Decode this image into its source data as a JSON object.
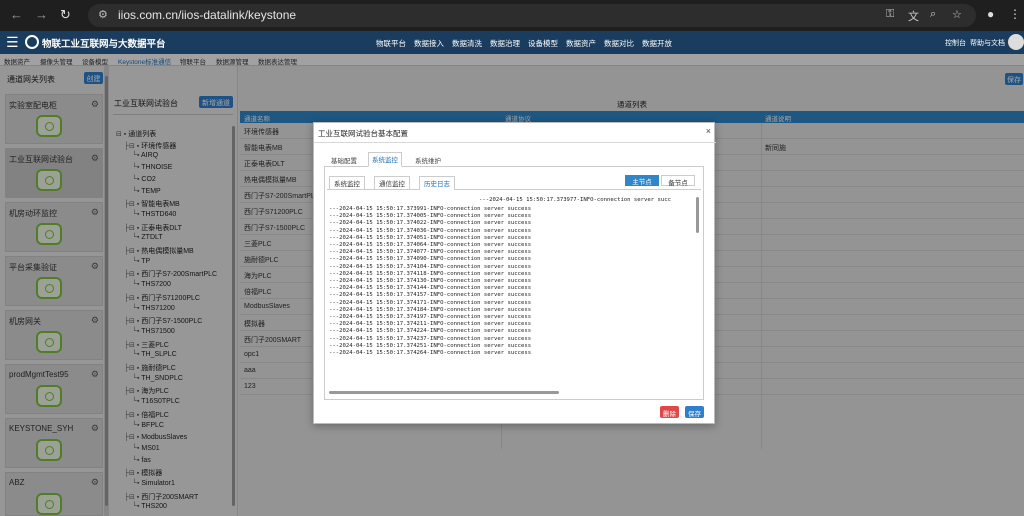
{
  "browser": {
    "url": "iios.com.cn/iios-datalink/keystone"
  },
  "header": {
    "brand": "物联工业互联网与大数据平台",
    "nav": [
      "物联平台",
      "数据接入",
      "数据清洗",
      "数据治理",
      "设备模型",
      "数据资产",
      "数据对比",
      "数据开放"
    ],
    "right": [
      "控制台",
      "帮助与文档"
    ]
  },
  "subnav": [
    "数据资产",
    "摄像头管理",
    "设备模型",
    "Keystone标准通信",
    "物联平台",
    "数据源管理",
    "数据表达管理"
  ],
  "left": {
    "title": "通道网关列表",
    "create": "创建",
    "gateways": [
      "实验室配电柜",
      "工业互联网试验台",
      "机房动环监控",
      "平台采集验证",
      "机房网关",
      "prodMgmtTest95",
      "KEYSTONE_SYH",
      "ABZ"
    ]
  },
  "tree": {
    "title": "工业互联网试验台",
    "new_channel": "新增通道",
    "nodes": [
      {
        "t": "通道列表",
        "d": 0
      },
      {
        "t": "环境传感器",
        "d": 1
      },
      {
        "t": "AIRQ",
        "d": 2
      },
      {
        "t": "THNOISE",
        "d": 2
      },
      {
        "t": "CO2",
        "d": 2
      },
      {
        "t": "TEMP",
        "d": 2
      },
      {
        "t": "智能电表MB",
        "d": 1
      },
      {
        "t": "THSTD640",
        "d": 2
      },
      {
        "t": "正泰电表DLT",
        "d": 1
      },
      {
        "t": "ZTDLT",
        "d": 2
      },
      {
        "t": "热电偶模拟量MB",
        "d": 1
      },
      {
        "t": "TP",
        "d": 2
      },
      {
        "t": "西门子S7-200SmartPLC",
        "d": 1
      },
      {
        "t": "THS7200",
        "d": 2
      },
      {
        "t": "西门子S71200PLC",
        "d": 1
      },
      {
        "t": "THS71200",
        "d": 2
      },
      {
        "t": "西门子S7-1500PLC",
        "d": 1
      },
      {
        "t": "THS71500",
        "d": 2
      },
      {
        "t": "三菱PLC",
        "d": 1
      },
      {
        "t": "TH_SLPLC",
        "d": 2
      },
      {
        "t": "施耐德PLC",
        "d": 1
      },
      {
        "t": "TH_SNDPLC",
        "d": 2
      },
      {
        "t": "海为PLC",
        "d": 1
      },
      {
        "t": "T16S0TPLC",
        "d": 2
      },
      {
        "t": "倍福PLC",
        "d": 1
      },
      {
        "t": "BFPLC",
        "d": 2
      },
      {
        "t": "ModbusSlaves",
        "d": 1
      },
      {
        "t": "MS01",
        "d": 2
      },
      {
        "t": "fas",
        "d": 2
      },
      {
        "t": "模拟器",
        "d": 1
      },
      {
        "t": "Simulator1",
        "d": 2
      },
      {
        "t": "西门子200SMART",
        "d": 1
      },
      {
        "t": "THS200",
        "d": 2
      }
    ]
  },
  "main": {
    "save": "保存",
    "list_title": "通道列表",
    "columns": [
      "通道名称",
      "通道协议",
      "",
      "通道说明"
    ],
    "rows": [
      "环境传感器",
      "智能电表MB",
      "正泰电表DLT",
      "热电偶模拟量MB",
      "西门子S7-200SmartPL",
      "西门子S71200PLC",
      "西门子S7-1500PLC",
      "三菱PLC",
      "施耐德PLC",
      "海为PLC",
      "倍福PLC",
      "ModbusSlaves",
      "模拟器",
      "西门子200SMART",
      "opc1",
      "aaa",
      "123"
    ],
    "row_note": "新同施"
  },
  "modal": {
    "title": "工业互联网试验台基本配置",
    "close": "×",
    "tabs": [
      "基础配置",
      "系统监控",
      "系统维护"
    ],
    "subtabs": [
      "系统监控",
      "通信监控",
      "历史日志"
    ],
    "nodes": [
      "主节点",
      "备节点"
    ],
    "log_first": "---2024-04-15 15:50:17.373977-INFO-connection server succ",
    "log_lines": [
      "---2024-04-15 15:50:17.373991-INFO-connection server success",
      "---2024-04-15 15:50:17.374005-INFO-connection server success",
      "---2024-04-15 15:50:17.374022-INFO-connection server success",
      "---2024-04-15 15:50:17.374036-INFO-connection server success",
      "---2024-04-15 15:50:17.374051-INFO-connection server success",
      "---2024-04-15 15:50:17.374064-INFO-connection server success",
      "---2024-04-15 15:50:17.374077-INFO-connection server success",
      "---2024-04-15 15:50:17.374090-INFO-connection server success",
      "---2024-04-15 15:50:17.374104-INFO-connection server success",
      "---2024-04-15 15:50:17.374118-INFO-connection server success",
      "---2024-04-15 15:50:17.374130-INFO-connection server success",
      "---2024-04-15 15:50:17.374144-INFO-connection server success",
      "---2024-04-15 15:50:17.374157-INFO-connection server success",
      "---2024-04-15 15:50:17.374171-INFO-connection server success",
      "---2024-04-15 15:50:17.374184-INFO-connection server success",
      "---2024-04-15 15:50:17.374197-INFO-connection server success",
      "---2024-04-15 15:50:17.374211-INFO-connection server success",
      "---2024-04-15 15:50:17.374224-INFO-connection server success",
      "---2024-04-15 15:50:17.374237-INFO-connection server success",
      "---2024-04-15 15:50:17.374251-INFO-connection server success",
      "---2024-04-15 15:50:17.374264-INFO-connection server success"
    ],
    "delete": "删除",
    "save": "保存"
  }
}
